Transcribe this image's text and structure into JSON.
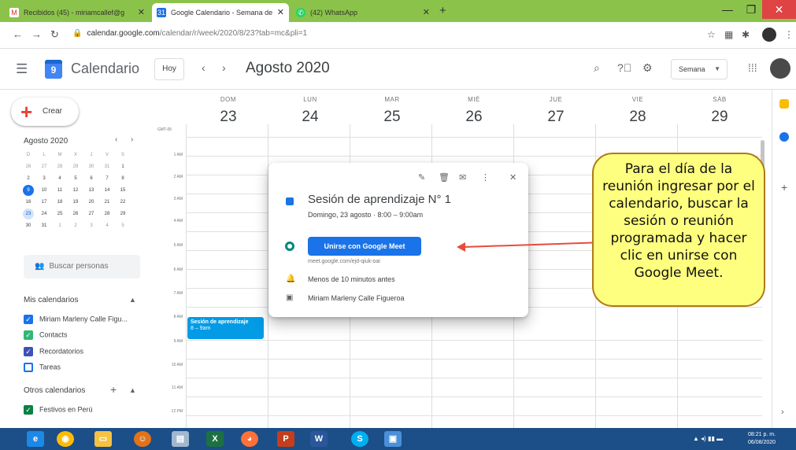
{
  "browser": {
    "tabs": [
      {
        "title": "Recibidos (45) - miriamcallef@g",
        "icon": "gmail-icon"
      },
      {
        "title": "Google Calendario - Semana de",
        "icon": "calendar-icon"
      },
      {
        "title": "(42) WhatsApp",
        "icon": "whatsapp-icon"
      }
    ],
    "url_host": "calendar.google.com",
    "url_path": "/calendar/r/week/2020/8/23?tab=mc&pli=1"
  },
  "header": {
    "app_title": "Calendario",
    "logo_day": "9",
    "today_label": "Hoy",
    "period": "Agosto 2020",
    "view_label": "Semana"
  },
  "sidebar": {
    "create_label": "Crear",
    "month_title": "Agosto 2020",
    "weekday_initials": [
      "D",
      "L",
      "M",
      "X",
      "J",
      "V",
      "S"
    ],
    "weeks": [
      [
        "26",
        "27",
        "28",
        "29",
        "30",
        "31",
        "1"
      ],
      [
        "2",
        "3",
        "4",
        "5",
        "6",
        "7",
        "8"
      ],
      [
        "9",
        "10",
        "11",
        "12",
        "13",
        "14",
        "15"
      ],
      [
        "16",
        "17",
        "18",
        "19",
        "20",
        "21",
        "22"
      ],
      [
        "23",
        "24",
        "25",
        "26",
        "27",
        "28",
        "29"
      ],
      [
        "30",
        "31",
        "1",
        "2",
        "3",
        "4",
        "5"
      ]
    ],
    "search_people": "Buscar personas",
    "my_calendars_title": "Mis calendarios",
    "my_calendars": [
      {
        "name": "Miriam Marleny Calle Figu...",
        "color": "#1a73e8",
        "checked": true
      },
      {
        "name": "Contacts",
        "color": "#33b679",
        "checked": true
      },
      {
        "name": "Recordatorios",
        "color": "#3f51b5",
        "checked": true
      },
      {
        "name": "Tareas",
        "color": "#1a73e8",
        "checked": false
      }
    ],
    "other_calendars_title": "Otros calendarios",
    "other_calendars": [
      {
        "name": "Festivos en Perú",
        "color": "#0b8043",
        "checked": true
      }
    ]
  },
  "grid": {
    "timezone": "GMT-05",
    "days": [
      {
        "dow": "DOM",
        "num": "23"
      },
      {
        "dow": "LUN",
        "num": "24"
      },
      {
        "dow": "MAR",
        "num": "25"
      },
      {
        "dow": "MIÉ",
        "num": "26"
      },
      {
        "dow": "JUE",
        "num": "27"
      },
      {
        "dow": "VIE",
        "num": "28"
      },
      {
        "dow": "SÁB",
        "num": "29"
      }
    ],
    "hours": [
      "1 AM",
      "2 AM",
      "3 AM",
      "4 AM",
      "5 AM",
      "6 AM",
      "7 AM",
      "8 AM",
      "9 AM",
      "10 AM",
      "11 AM",
      "12 PM"
    ],
    "event": {
      "title": "Sesión de aprendizaje",
      "time": "8 – 9am"
    }
  },
  "popup": {
    "title": "Sesión de aprendizaje N° 1",
    "datetime": "Domingo, 23 agosto · 8:00 – 9:00am",
    "join_button": "Unirse con Google Meet",
    "meet_link": "meet.google.com/ejd-qiuk-oai",
    "reminder": "Menos de 10 minutos antes",
    "organizer": "Miriam Marleny Calle Figueroa"
  },
  "annotation": {
    "text": "Para el día de la reunión ingresar por el calendario, buscar la sesión o reunión programada y hacer clic en unirse con Google Meet."
  },
  "taskbar": {
    "time": "08:21 p. m.",
    "date": "06/08/2020"
  }
}
